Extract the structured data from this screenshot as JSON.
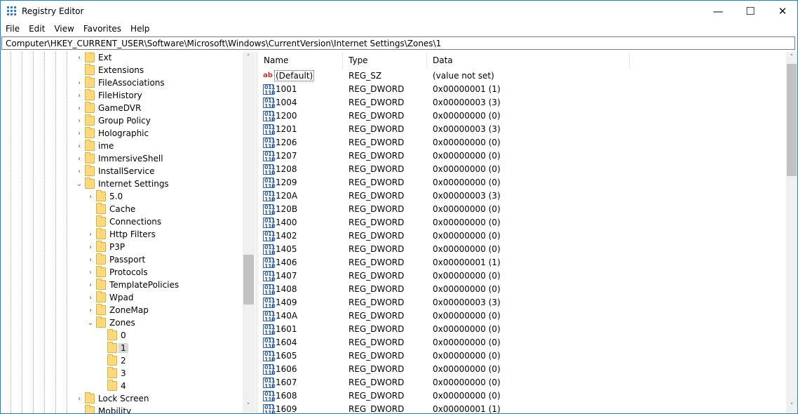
{
  "window": {
    "title": "Registry Editor",
    "minimize_glyph": "—",
    "maximize_glyph": "☐",
    "close_glyph": "✕"
  },
  "menu": [
    "File",
    "Edit",
    "View",
    "Favorites",
    "Help"
  ],
  "address": "Computer\\HKEY_CURRENT_USER\\Software\\Microsoft\\Windows\\CurrentVersion\\Internet Settings\\Zones\\1",
  "tree": [
    {
      "label": "Ext",
      "expander": "›",
      "depth": 0
    },
    {
      "label": "Extensions",
      "expander": "",
      "depth": 0
    },
    {
      "label": "FileAssociations",
      "expander": "›",
      "depth": 0
    },
    {
      "label": "FileHistory",
      "expander": "›",
      "depth": 0
    },
    {
      "label": "GameDVR",
      "expander": "›",
      "depth": 0
    },
    {
      "label": "Group Policy",
      "expander": "›",
      "depth": 0
    },
    {
      "label": "Holographic",
      "expander": "›",
      "depth": 0
    },
    {
      "label": "ime",
      "expander": "›",
      "depth": 0
    },
    {
      "label": "ImmersiveShell",
      "expander": "›",
      "depth": 0
    },
    {
      "label": "InstallService",
      "expander": "›",
      "depth": 0
    },
    {
      "label": "Internet Settings",
      "expander": "⌄",
      "depth": 0
    },
    {
      "label": "5.0",
      "expander": "›",
      "depth": 1
    },
    {
      "label": "Cache",
      "expander": "",
      "depth": 1
    },
    {
      "label": "Connections",
      "expander": "",
      "depth": 1
    },
    {
      "label": "Http Filters",
      "expander": "›",
      "depth": 1
    },
    {
      "label": "P3P",
      "expander": "›",
      "depth": 1
    },
    {
      "label": "Passport",
      "expander": "›",
      "depth": 1
    },
    {
      "label": "Protocols",
      "expander": "›",
      "depth": 1
    },
    {
      "label": "TemplatePolicies",
      "expander": "›",
      "depth": 1
    },
    {
      "label": "Wpad",
      "expander": "›",
      "depth": 1
    },
    {
      "label": "ZoneMap",
      "expander": "›",
      "depth": 1
    },
    {
      "label": "Zones",
      "expander": "⌄",
      "depth": 1
    },
    {
      "label": "0",
      "expander": "",
      "depth": 2
    },
    {
      "label": "1",
      "expander": "",
      "depth": 2,
      "selected": true
    },
    {
      "label": "2",
      "expander": "",
      "depth": 2
    },
    {
      "label": "3",
      "expander": "",
      "depth": 2
    },
    {
      "label": "4",
      "expander": "",
      "depth": 2
    },
    {
      "label": "Lock Screen",
      "expander": "›",
      "depth": 0
    },
    {
      "label": "Mobility",
      "expander": "",
      "depth": 0
    }
  ],
  "tree_scroll": {
    "up": "˄",
    "down": "˅"
  },
  "values_scroll": {
    "up": "˄",
    "down": "˅"
  },
  "columns": {
    "name": "Name",
    "type": "Type",
    "data": "Data"
  },
  "values": [
    {
      "name": "(Default)",
      "type": "REG_SZ",
      "data": "(value not set)",
      "icon": "string-icon",
      "icon_text": "ab"
    },
    {
      "name": "1001",
      "type": "REG_DWORD",
      "data": "0x00000001 (1)",
      "icon": "binary-icon"
    },
    {
      "name": "1004",
      "type": "REG_DWORD",
      "data": "0x00000003 (3)",
      "icon": "binary-icon"
    },
    {
      "name": "1200",
      "type": "REG_DWORD",
      "data": "0x00000000 (0)",
      "icon": "binary-icon"
    },
    {
      "name": "1201",
      "type": "REG_DWORD",
      "data": "0x00000003 (3)",
      "icon": "binary-icon"
    },
    {
      "name": "1206",
      "type": "REG_DWORD",
      "data": "0x00000000 (0)",
      "icon": "binary-icon"
    },
    {
      "name": "1207",
      "type": "REG_DWORD",
      "data": "0x00000000 (0)",
      "icon": "binary-icon"
    },
    {
      "name": "1208",
      "type": "REG_DWORD",
      "data": "0x00000000 (0)",
      "icon": "binary-icon"
    },
    {
      "name": "1209",
      "type": "REG_DWORD",
      "data": "0x00000000 (0)",
      "icon": "binary-icon"
    },
    {
      "name": "120A",
      "type": "REG_DWORD",
      "data": "0x00000003 (3)",
      "icon": "binary-icon"
    },
    {
      "name": "120B",
      "type": "REG_DWORD",
      "data": "0x00000000 (0)",
      "icon": "binary-icon"
    },
    {
      "name": "1400",
      "type": "REG_DWORD",
      "data": "0x00000000 (0)",
      "icon": "binary-icon"
    },
    {
      "name": "1402",
      "type": "REG_DWORD",
      "data": "0x00000000 (0)",
      "icon": "binary-icon"
    },
    {
      "name": "1405",
      "type": "REG_DWORD",
      "data": "0x00000000 (0)",
      "icon": "binary-icon"
    },
    {
      "name": "1406",
      "type": "REG_DWORD",
      "data": "0x00000001 (1)",
      "icon": "binary-icon"
    },
    {
      "name": "1407",
      "type": "REG_DWORD",
      "data": "0x00000000 (0)",
      "icon": "binary-icon"
    },
    {
      "name": "1408",
      "type": "REG_DWORD",
      "data": "0x00000000 (0)",
      "icon": "binary-icon"
    },
    {
      "name": "1409",
      "type": "REG_DWORD",
      "data": "0x00000003 (3)",
      "icon": "binary-icon"
    },
    {
      "name": "140A",
      "type": "REG_DWORD",
      "data": "0x00000000 (0)",
      "icon": "binary-icon"
    },
    {
      "name": "1601",
      "type": "REG_DWORD",
      "data": "0x00000000 (0)",
      "icon": "binary-icon"
    },
    {
      "name": "1604",
      "type": "REG_DWORD",
      "data": "0x00000000 (0)",
      "icon": "binary-icon"
    },
    {
      "name": "1605",
      "type": "REG_DWORD",
      "data": "0x00000000 (0)",
      "icon": "binary-icon"
    },
    {
      "name": "1606",
      "type": "REG_DWORD",
      "data": "0x00000000 (0)",
      "icon": "binary-icon"
    },
    {
      "name": "1607",
      "type": "REG_DWORD",
      "data": "0x00000000 (0)",
      "icon": "binary-icon"
    },
    {
      "name": "1608",
      "type": "REG_DWORD",
      "data": "0x00000000 (0)",
      "icon": "binary-icon"
    },
    {
      "name": "1609",
      "type": "REG_DWORD",
      "data": "0x00000001 (1)",
      "icon": "binary-icon"
    }
  ],
  "colors": {
    "title_border": "#1883d7",
    "folder": "#ffd97a",
    "selection": "#d9d9d9"
  }
}
